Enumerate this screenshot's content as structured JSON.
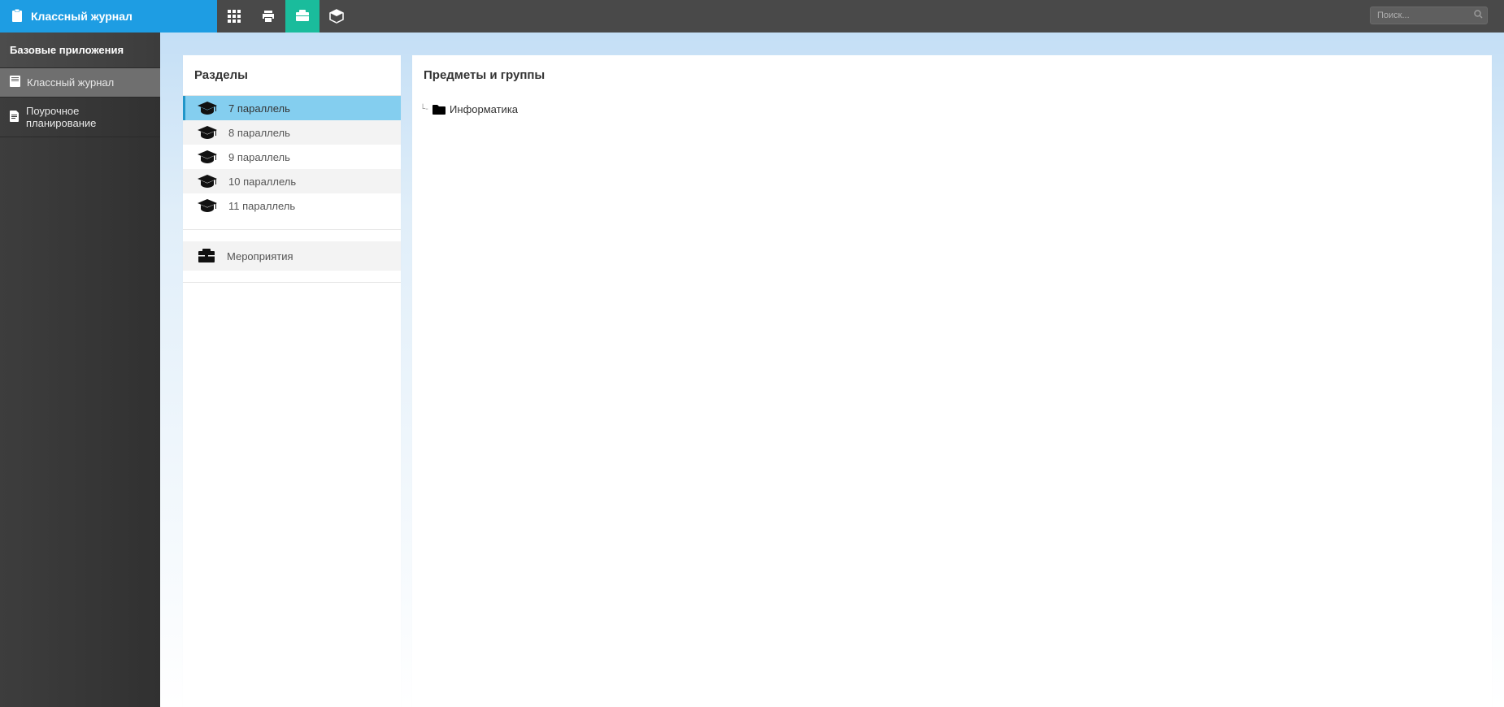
{
  "brand": {
    "title": "Классный журнал"
  },
  "search": {
    "placeholder": "Поиск..."
  },
  "sidebar": {
    "header": "Базовые приложения",
    "items": [
      {
        "label": "Классный журнал",
        "icon": "book",
        "active": true
      },
      {
        "label": "Поурочное планирование",
        "icon": "file",
        "active": false
      }
    ]
  },
  "sections_panel": {
    "title": "Разделы",
    "items": [
      {
        "label": "7 параллель",
        "selected": true
      },
      {
        "label": "8 параллель",
        "selected": false
      },
      {
        "label": "9 параллель",
        "selected": false
      },
      {
        "label": "10 параллель",
        "selected": false
      },
      {
        "label": "11 параллель",
        "selected": false
      }
    ],
    "events_label": "Мероприятия"
  },
  "main_panel": {
    "title": "Предметы и группы",
    "tree": [
      {
        "label": "Информатика"
      }
    ]
  }
}
